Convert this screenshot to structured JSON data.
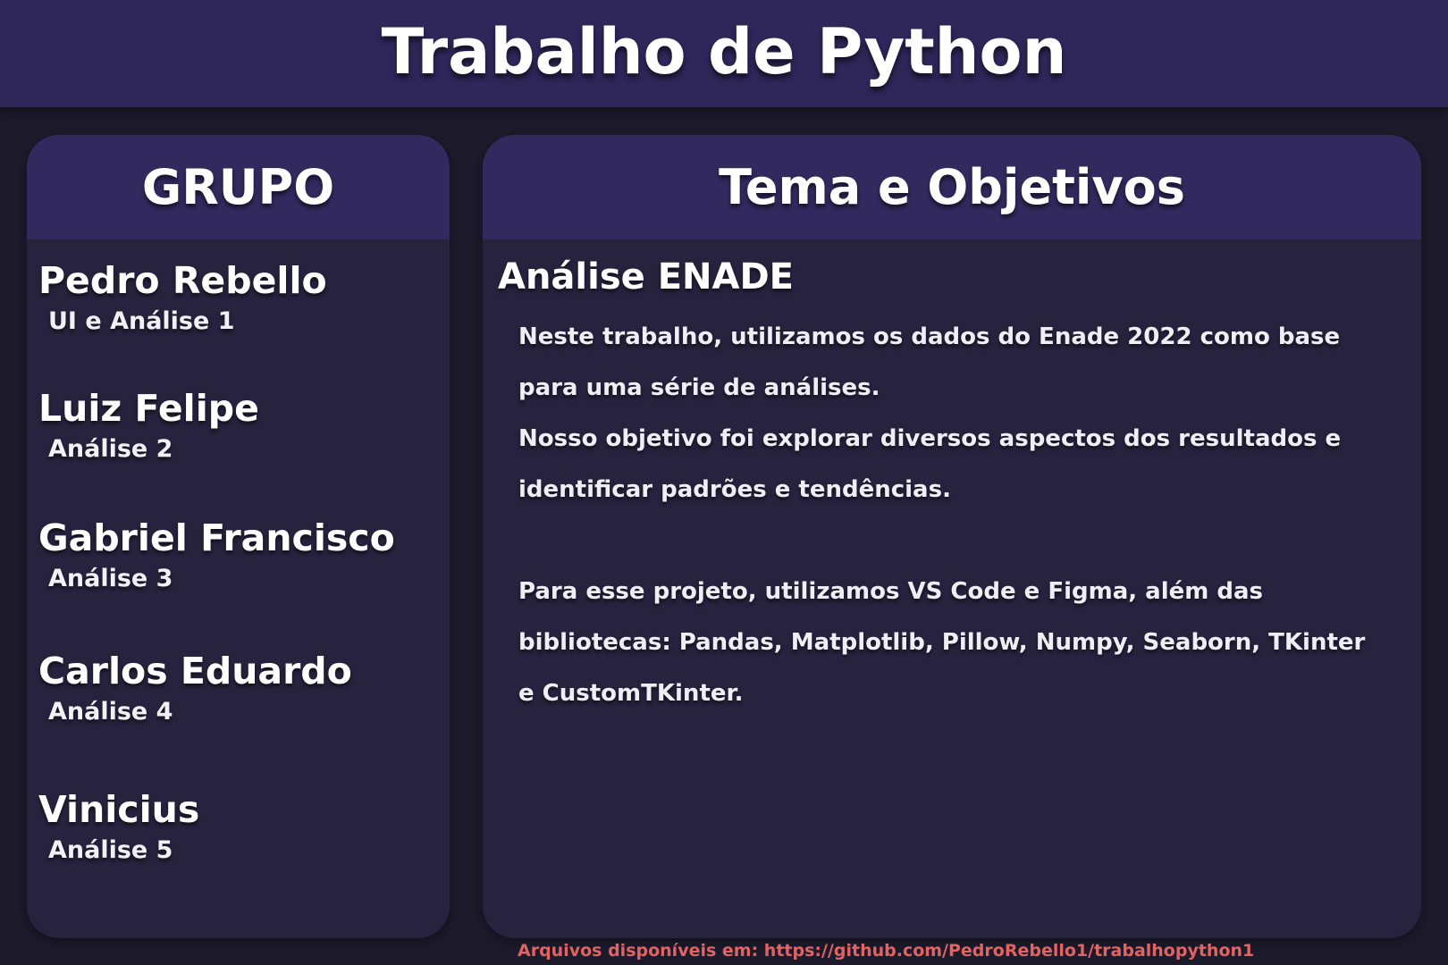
{
  "header": {
    "title": "Trabalho de Python"
  },
  "group_panel": {
    "title": "GRUPO",
    "members": [
      {
        "name": "Pedro Rebello",
        "role": "UI e Análise 1"
      },
      {
        "name": "Luiz Felipe",
        "role": "Análise 2"
      },
      {
        "name": "Gabriel Francisco",
        "role": "Análise 3"
      },
      {
        "name": "Carlos Eduardo",
        "role": "Análise 4"
      },
      {
        "name": "Vinicius",
        "role": "Análise 5"
      }
    ]
  },
  "theme_panel": {
    "title": "Tema e Objetivos",
    "heading": "Análise ENADE",
    "lines": [
      "Neste trabalho, utilizamos os dados do Enade 2022 como base",
      "para uma série de análises.",
      "Nosso objetivo foi explorar diversos aspectos dos resultados e",
      "identificar padrões e tendências.",
      "",
      "Para esse projeto, utilizamos VS Code e Figma, além das",
      "bibliotecas: Pandas, Matplotlib, Pillow, Numpy, Seaborn, TKinter",
      "e CustomTKinter."
    ]
  },
  "footer": {
    "link_text": "Arquivos disponíveis em: https://github.com/PedroRebello1/trabalhopython1"
  },
  "colors": {
    "background": "#1c1a2b",
    "header_bg": "#2f2659",
    "panel_bg": "#27233f",
    "panel_header_bg": "#322a5f",
    "link": "#e36363"
  }
}
